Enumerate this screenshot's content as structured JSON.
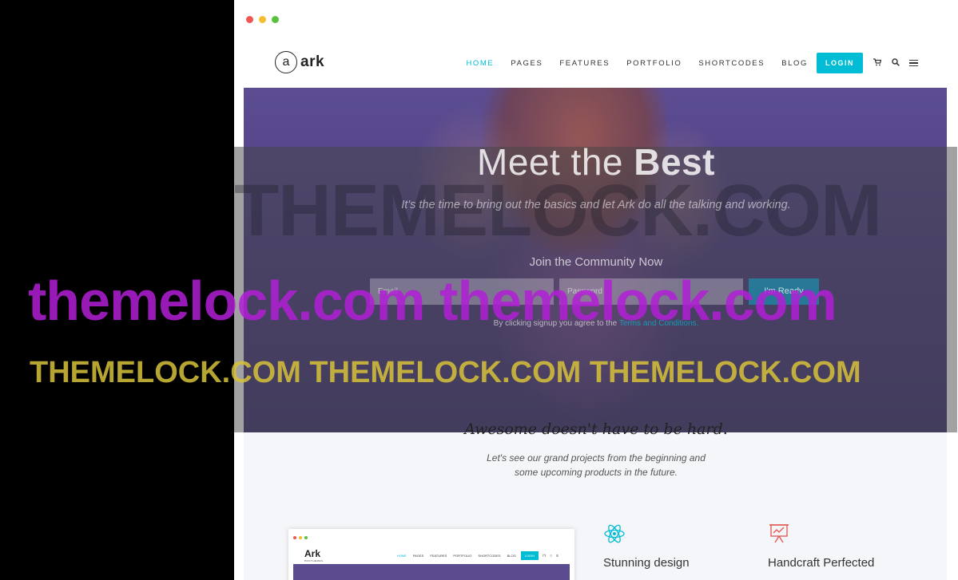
{
  "window": {
    "traffic_lights": [
      "close",
      "minimize",
      "maximize"
    ]
  },
  "header": {
    "logo_letter": "a",
    "logo_text": "ark",
    "nav": [
      {
        "label": "HOME",
        "active": true
      },
      {
        "label": "PAGES",
        "active": false
      },
      {
        "label": "FEATURES",
        "active": false
      },
      {
        "label": "PORTFOLIO",
        "active": false
      },
      {
        "label": "SHORTCODES",
        "active": false
      },
      {
        "label": "BLOG",
        "active": false
      }
    ],
    "login_label": "LOGIN",
    "icons": [
      "cart-icon",
      "search-icon",
      "menu-icon"
    ]
  },
  "hero": {
    "title_light": "Meet the ",
    "title_bold": "Best",
    "subtitle": "It's the time to bring out the basics and let Ark do all the talking and working.",
    "join_label": "Join the Community Now",
    "email_placeholder": "Email",
    "password_placeholder": "Password",
    "submit_label": "I'm Ready",
    "terms_prefix": "By clicking signup you agree to the ",
    "terms_link": "Terms and Conditions."
  },
  "watermarks": {
    "big": "THEMELOCK.COM",
    "magenta": "themelock.com themelock.com",
    "yellow": "THEMELOCK.COM THEMELOCK.COM THEMELOCK.COM"
  },
  "intro": {
    "tagline": "Awesome doesn't have to be hard.",
    "lead_line1": "Let's see our grand projects from the beginning and",
    "lead_line2": "some upcoming products in the future."
  },
  "preview": {
    "logo": "Ark",
    "logo_sub": "PROTHEMES",
    "nav": [
      "HOME",
      "PAGES",
      "FEATURES",
      "PORTFOLIO",
      "SHORTCODES",
      "BLOG"
    ],
    "login": "LOGIN"
  },
  "features": [
    {
      "title": "Stunning design",
      "icon": "atom-icon"
    },
    {
      "title": "Handcraft Perfected",
      "icon": "presentation-chart-icon"
    }
  ],
  "colors": {
    "accent": "#00bcd4",
    "hero_purple": "#4f3f86",
    "watermark_magenta": "#b21fd6",
    "watermark_yellow": "#d8c23a"
  }
}
